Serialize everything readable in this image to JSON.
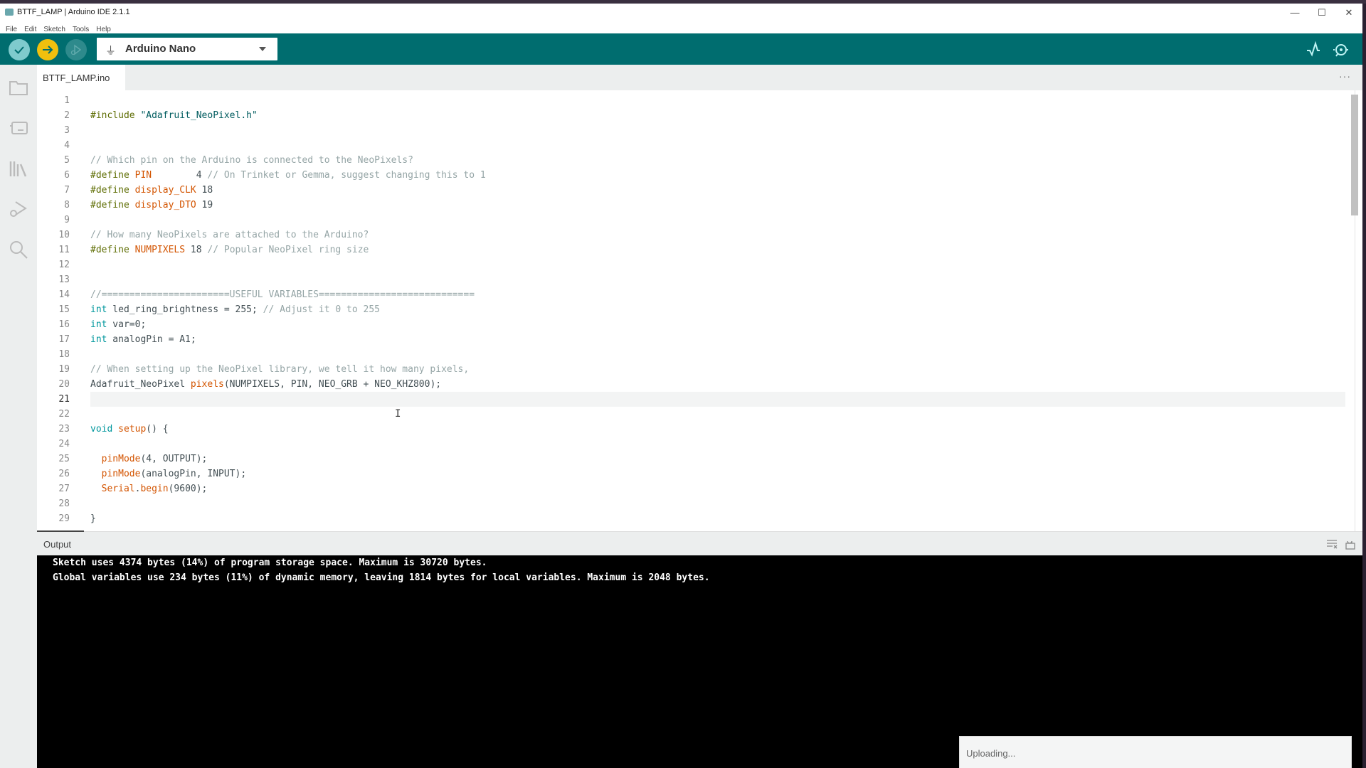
{
  "window": {
    "title": "BTTF_LAMP | Arduino IDE 2.1.1",
    "minimize_glyph": "—",
    "maximize_glyph": "☐",
    "close_glyph": "✕"
  },
  "menu": [
    "File",
    "Edit",
    "Sketch",
    "Tools",
    "Help"
  ],
  "toolbar": {
    "verify_icon": "check-icon",
    "upload_icon": "arrow-right-icon",
    "debug_icon": "debug-icon",
    "board_name": "Arduino Nano",
    "usb_glyph": "⏚",
    "serial_plotter_icon": "serial-plotter-icon",
    "serial_monitor_icon": "serial-monitor-icon",
    "colors": {
      "bar": "#006d6f",
      "verify": "#7fcbcd",
      "upload": "#f0c00e"
    }
  },
  "sidebar": [
    "sketchbook-icon",
    "boards-manager-icon",
    "library-manager-icon",
    "debug-icon",
    "search-icon"
  ],
  "tabs": [
    {
      "label": "BTTF_LAMP.ino",
      "active": true
    }
  ],
  "tab_more": "···",
  "editor": {
    "active_line": 21,
    "lines": [
      {
        "n": "1",
        "t": []
      },
      {
        "n": "2",
        "t": [
          [
            "pp",
            "#include "
          ],
          [
            "str",
            "\"Adafruit_NeoPixel.h\""
          ]
        ]
      },
      {
        "n": "3",
        "t": []
      },
      {
        "n": "4",
        "t": []
      },
      {
        "n": "5",
        "t": [
          [
            "cm",
            "// Which pin on the Arduino is connected to the NeoPixels?"
          ]
        ]
      },
      {
        "n": "6",
        "t": [
          [
            "pp",
            "#define "
          ],
          [
            "fn",
            "PIN"
          ],
          [
            "id",
            "        4 "
          ],
          [
            "cm",
            "// On Trinket or Gemma, suggest changing this to 1"
          ]
        ]
      },
      {
        "n": "7",
        "t": [
          [
            "pp",
            "#define "
          ],
          [
            "fn",
            "display_CLK"
          ],
          [
            "id",
            " 18"
          ]
        ]
      },
      {
        "n": "8",
        "t": [
          [
            "pp",
            "#define "
          ],
          [
            "fn",
            "display_DTO"
          ],
          [
            "id",
            " 19"
          ]
        ]
      },
      {
        "n": "9",
        "t": []
      },
      {
        "n": "10",
        "t": [
          [
            "cm",
            "// How many NeoPixels are attached to the Arduino?"
          ]
        ]
      },
      {
        "n": "11",
        "t": [
          [
            "pp",
            "#define "
          ],
          [
            "fn",
            "NUMPIXELS"
          ],
          [
            "id",
            " 18 "
          ],
          [
            "cm",
            "// Popular NeoPixel ring size"
          ]
        ]
      },
      {
        "n": "12",
        "t": []
      },
      {
        "n": "13",
        "t": []
      },
      {
        "n": "14",
        "t": [
          [
            "cm",
            "//=======================USEFUL VARIABLES============================"
          ]
        ]
      },
      {
        "n": "15",
        "t": [
          [
            "ty",
            "int"
          ],
          [
            "id",
            " led_ring_brightness = 255; "
          ],
          [
            "cm",
            "// Adjust it 0 to 255"
          ]
        ]
      },
      {
        "n": "16",
        "t": [
          [
            "ty",
            "int"
          ],
          [
            "id",
            " var=0;"
          ]
        ]
      },
      {
        "n": "17",
        "t": [
          [
            "ty",
            "int"
          ],
          [
            "id",
            " analogPin = A1;"
          ]
        ]
      },
      {
        "n": "18",
        "t": []
      },
      {
        "n": "19",
        "t": [
          [
            "cm",
            "// When setting up the NeoPixel library, we tell it how many pixels,"
          ]
        ]
      },
      {
        "n": "20",
        "t": [
          [
            "id",
            "Adafruit_NeoPixel "
          ],
          [
            "fn",
            "pixels"
          ],
          [
            "id",
            "(NUMPIXELS, PIN, NEO_GRB + NEO_KHZ800);"
          ]
        ]
      },
      {
        "n": "21",
        "t": []
      },
      {
        "n": "22",
        "t": []
      },
      {
        "n": "23",
        "t": [
          [
            "ty",
            "void"
          ],
          [
            "id",
            " "
          ],
          [
            "fn",
            "setup"
          ],
          [
            "id",
            "() {"
          ]
        ]
      },
      {
        "n": "24",
        "t": []
      },
      {
        "n": "25",
        "t": [
          [
            "id",
            "  "
          ],
          [
            "fn",
            "pinMode"
          ],
          [
            "id",
            "(4, OUTPUT);"
          ]
        ]
      },
      {
        "n": "26",
        "t": [
          [
            "id",
            "  "
          ],
          [
            "fn",
            "pinMode"
          ],
          [
            "id",
            "(analogPin, INPUT);"
          ]
        ]
      },
      {
        "n": "27",
        "t": [
          [
            "id",
            "  "
          ],
          [
            "fn",
            "Serial"
          ],
          [
            "id",
            "."
          ],
          [
            "fn",
            "begin"
          ],
          [
            "id",
            "(9600);"
          ]
        ]
      },
      {
        "n": "28",
        "t": []
      },
      {
        "n": "29",
        "t": [
          [
            "id",
            "}"
          ]
        ]
      }
    ]
  },
  "output": {
    "title": "Output",
    "clear_icon": "clear-output-icon",
    "lock_icon": "unlock-scroll-icon",
    "lines": [
      "Sketch uses 4374 bytes (14%) of program storage space. Maximum is 30720 bytes.",
      "Global variables use 234 bytes (11%) of dynamic memory, leaving 1814 bytes for local variables. Maximum is 2048 bytes."
    ]
  },
  "notification": {
    "text": "Uploading..."
  }
}
